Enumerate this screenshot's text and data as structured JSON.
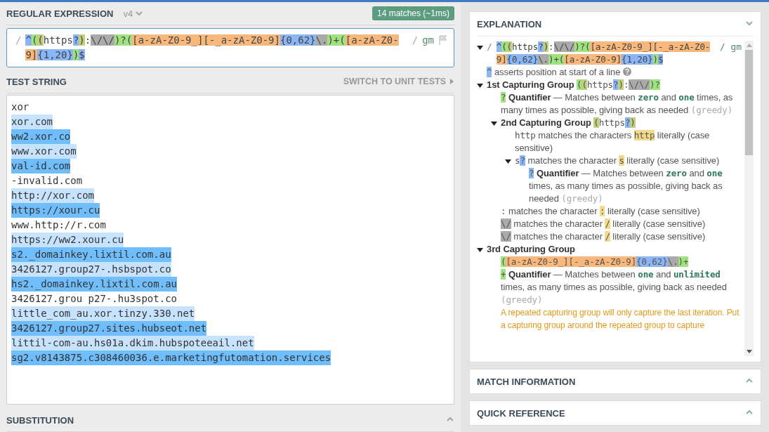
{
  "regex": {
    "title": "REGULAR EXPRESSION",
    "version": "v4",
    "matches": "14 matches (~1ms)",
    "delimiter": "/",
    "flags": "gm",
    "tokens": [
      {
        "text": "^",
        "kind": "quant"
      },
      {
        "text": "(",
        "kind": "group"
      },
      {
        "text": "(",
        "kind": "group2"
      },
      {
        "text": "https",
        "kind": "plain"
      },
      {
        "text": "?",
        "kind": "quant"
      },
      {
        "text": ")",
        "kind": "group2"
      },
      {
        "text": ":",
        "kind": "plain"
      },
      {
        "text": "\\/\\/",
        "kind": "escape"
      },
      {
        "text": ")?(",
        "kind": "group"
      },
      {
        "text": "[a-zA-Z0-9_]",
        "kind": "set"
      },
      {
        "text": "[-_a-zA-Z0-9]",
        "kind": "set"
      },
      {
        "text": "{0,62}",
        "kind": "quant"
      },
      {
        "text": "\\.",
        "kind": "escape"
      },
      {
        "text": ")+(",
        "kind": "group"
      },
      {
        "text": "[a-zA-Z0-9]",
        "kind": "set"
      },
      {
        "text": "{1,20}",
        "kind": "quant"
      },
      {
        "text": ")",
        "kind": "group"
      },
      {
        "text": "$",
        "kind": "quant"
      }
    ]
  },
  "test_string": {
    "title": "TEST STRING",
    "switch_link": "SWITCH TO UNIT TESTS",
    "lines": [
      {
        "text": "xor",
        "matched": false
      },
      {
        "text": "xor.com",
        "matched": true
      },
      {
        "text": "ww2.xor.co",
        "matched": true
      },
      {
        "text": "www.xor.com",
        "matched": true
      },
      {
        "text": "val-id.com",
        "matched": true
      },
      {
        "text": "-invalid.com",
        "matched": false
      },
      {
        "text": "http://xor.com",
        "matched": true
      },
      {
        "text": "https://xour.cu",
        "matched": true
      },
      {
        "text": "www.http://r.com",
        "matched": false
      },
      {
        "text": "https://ww2.xour.cu",
        "matched": true
      },
      {
        "text": "s2._domainkey.lixtil.com.au",
        "matched": true
      },
      {
        "text": "3426127.group27-.hsbspot.co",
        "matched": true
      },
      {
        "text": "hs2._domainkey.lixtil.com.au",
        "matched": true
      },
      {
        "text": "3426127.grou p27-.hu3spot.co",
        "matched": false
      },
      {
        "text": "little_com_au.xor.tinzy.330.net",
        "matched": true
      },
      {
        "text": "3426127.group27.sites.hubseot.net",
        "matched": true
      },
      {
        "text": "littil-com-au.hs01a.dkim.hubspoteeail.net",
        "matched": true
      },
      {
        "text": "sg2.v8143875.c308460036.e.marketingfutomation.services",
        "matched": true
      }
    ]
  },
  "substitution": {
    "title": "SUBSTITUTION",
    "expanded": false
  },
  "explanation": {
    "title": "EXPLANATION",
    "expanded": true,
    "tree": [
      {
        "kind": "pattern",
        "expanded": true,
        "delimiter": "/",
        "flags": "gm",
        "tokens": [
          {
            "text": "^",
            "kind": "quant"
          },
          {
            "text": "(",
            "kind": "group"
          },
          {
            "text": "(",
            "kind": "group2"
          },
          {
            "text": "https",
            "kind": "plain"
          },
          {
            "text": "?",
            "kind": "quant"
          },
          {
            "text": ")",
            "kind": "group2"
          },
          {
            "text": ":",
            "kind": "plain"
          },
          {
            "text": "\\/\\/",
            "kind": "escape"
          },
          {
            "text": ")?(",
            "kind": "group"
          },
          {
            "text": "[a-zA-Z0-9_]",
            "kind": "set"
          },
          {
            "text": "[-_a-zA-Z0-9]",
            "kind": "set"
          },
          {
            "text": "{0,62}",
            "kind": "quant"
          },
          {
            "text": "\\.",
            "kind": "escape"
          },
          {
            "text": ")+(",
            "kind": "group"
          },
          {
            "text": "[a-zA-Z0-9]",
            "kind": "set"
          },
          {
            "text": "{1,20}",
            "kind": "quant"
          },
          {
            "text": ")",
            "kind": "group"
          },
          {
            "text": "$",
            "kind": "quant"
          }
        ],
        "children": [
          {
            "kind": "line",
            "help": true,
            "parts": [
              {
                "text": "^",
                "kind": "quant"
              },
              {
                "text": " asserts position at start of a line",
                "kind": "text"
              }
            ]
          },
          {
            "kind": "line",
            "expanded": true,
            "parts": [
              {
                "text": "1st Capturing Group ",
                "kind": "bold"
              },
              {
                "text": "(",
                "kind": "group"
              },
              {
                "text": "(",
                "kind": "group2"
              },
              {
                "text": "https",
                "kind": "plain"
              },
              {
                "text": "?",
                "kind": "quant"
              },
              {
                "text": ")",
                "kind": "group2"
              },
              {
                "text": ":",
                "kind": "plain"
              },
              {
                "text": "\\/\\/",
                "kind": "escape"
              },
              {
                "text": ")?",
                "kind": "group"
              }
            ],
            "children": [
              {
                "kind": "line",
                "parts": [
                  {
                    "text": "?",
                    "kind": "group"
                  },
                  {
                    "text": " Quantifier",
                    "kind": "bold"
                  },
                  {
                    "text": " — Matches between ",
                    "kind": "text"
                  },
                  {
                    "text": "zero",
                    "kind": "code"
                  },
                  {
                    "text": " and ",
                    "kind": "text"
                  },
                  {
                    "text": "one",
                    "kind": "code"
                  },
                  {
                    "text": " times, as many times as possible, giving back as needed ",
                    "kind": "text"
                  },
                  {
                    "text": "(greedy)",
                    "kind": "greedy"
                  }
                ]
              },
              {
                "kind": "line",
                "expanded": true,
                "parts": [
                  {
                    "text": "2nd Capturing Group ",
                    "kind": "bold"
                  },
                  {
                    "text": "(",
                    "kind": "group2"
                  },
                  {
                    "text": "https",
                    "kind": "plain"
                  },
                  {
                    "text": "?",
                    "kind": "quant"
                  },
                  {
                    "text": ")",
                    "kind": "group2"
                  }
                ],
                "children": [
                  {
                    "kind": "line",
                    "parts": [
                      {
                        "text": "http",
                        "kind": "plain"
                      },
                      {
                        "text": " matches the characters ",
                        "kind": "text"
                      },
                      {
                        "text": "http",
                        "kind": "lit"
                      },
                      {
                        "text": " literally (case sensitive)",
                        "kind": "text"
                      }
                    ]
                  },
                  {
                    "kind": "line",
                    "expanded": true,
                    "parts": [
                      {
                        "text": "s",
                        "kind": "plain"
                      },
                      {
                        "text": "?",
                        "kind": "quant"
                      },
                      {
                        "text": " matches the character ",
                        "kind": "text"
                      },
                      {
                        "text": "s",
                        "kind": "lit"
                      },
                      {
                        "text": " literally (case sensitive)",
                        "kind": "text"
                      }
                    ],
                    "children": [
                      {
                        "kind": "line",
                        "parts": [
                          {
                            "text": "?",
                            "kind": "quant"
                          },
                          {
                            "text": " Quantifier",
                            "kind": "bold"
                          },
                          {
                            "text": " — Matches between ",
                            "kind": "text"
                          },
                          {
                            "text": "zero",
                            "kind": "code"
                          },
                          {
                            "text": " and ",
                            "kind": "text"
                          },
                          {
                            "text": "one",
                            "kind": "code"
                          },
                          {
                            "text": " times, as many times as possible, giving back as needed ",
                            "kind": "text"
                          },
                          {
                            "text": "(greedy)",
                            "kind": "greedy"
                          }
                        ]
                      }
                    ]
                  }
                ]
              },
              {
                "kind": "line",
                "parts": [
                  {
                    "text": ":",
                    "kind": "plain"
                  },
                  {
                    "text": " matches the character ",
                    "kind": "text"
                  },
                  {
                    "text": ":",
                    "kind": "lit"
                  },
                  {
                    "text": " literally (case sensitive)",
                    "kind": "text"
                  }
                ]
              },
              {
                "kind": "line",
                "parts": [
                  {
                    "text": "\\/",
                    "kind": "escape"
                  },
                  {
                    "text": " matches the character ",
                    "kind": "text"
                  },
                  {
                    "text": "/",
                    "kind": "lit"
                  },
                  {
                    "text": " literally (case sensitive)",
                    "kind": "text"
                  }
                ]
              },
              {
                "kind": "line",
                "parts": [
                  {
                    "text": "\\/",
                    "kind": "escape"
                  },
                  {
                    "text": " matches the character ",
                    "kind": "text"
                  },
                  {
                    "text": "/",
                    "kind": "lit"
                  },
                  {
                    "text": " literally (case sensitive)",
                    "kind": "text"
                  }
                ]
              }
            ]
          },
          {
            "kind": "line",
            "expanded": true,
            "parts": [
              {
                "text": "3rd Capturing Group",
                "kind": "bold"
              }
            ],
            "children": [
              {
                "kind": "line",
                "parts": [
                  {
                    "text": "(",
                    "kind": "group"
                  },
                  {
                    "text": "[a-zA-Z0-9_]",
                    "kind": "set"
                  },
                  {
                    "text": "[-_a-zA-Z0-9]",
                    "kind": "set"
                  },
                  {
                    "text": "{0,62}",
                    "kind": "quant"
                  },
                  {
                    "text": "\\.",
                    "kind": "escape"
                  },
                  {
                    "text": ")+",
                    "kind": "group"
                  }
                ]
              },
              {
                "kind": "line",
                "parts": [
                  {
                    "text": "+",
                    "kind": "group"
                  },
                  {
                    "text": " Quantifier",
                    "kind": "bold"
                  },
                  {
                    "text": " — Matches between ",
                    "kind": "text"
                  },
                  {
                    "text": "one",
                    "kind": "code"
                  },
                  {
                    "text": " and ",
                    "kind": "text"
                  },
                  {
                    "text": "unlimited",
                    "kind": "code"
                  },
                  {
                    "text": " times, as many times as possible, giving back as needed ",
                    "kind": "text"
                  },
                  {
                    "text": "(greedy)",
                    "kind": "greedy"
                  }
                ]
              },
              {
                "kind": "line",
                "parts": [
                  {
                    "text": "A repeated capturing group will only capture the last iteration. Put a capturing group around the repeated group to capture",
                    "kind": "warn"
                  }
                ]
              }
            ]
          }
        ]
      }
    ]
  },
  "match_information": {
    "title": "MATCH INFORMATION",
    "expanded": false
  },
  "quick_reference": {
    "title": "QUICK REFERENCE",
    "expanded": false
  }
}
